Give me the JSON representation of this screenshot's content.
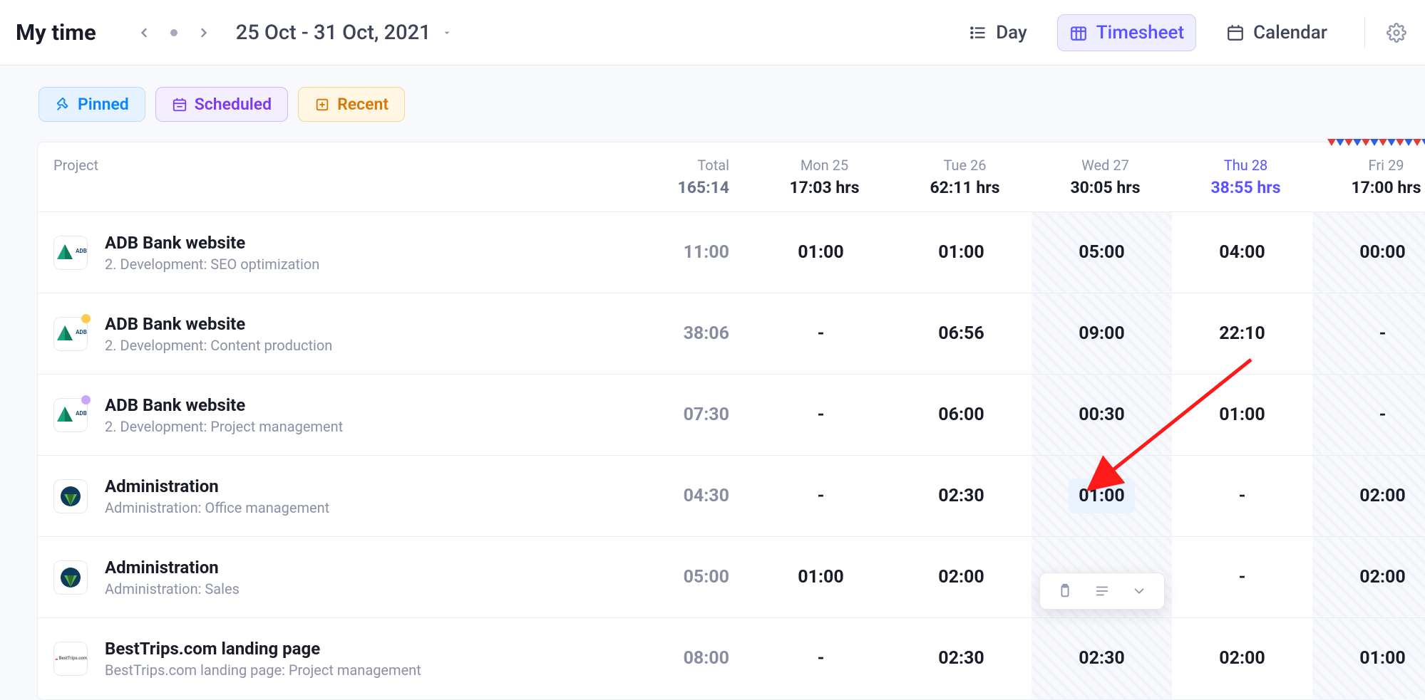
{
  "header": {
    "title": "My time",
    "date_range": "25 Oct - 31 Oct, 2021",
    "views": {
      "day": "Day",
      "timesheet": "Timesheet",
      "calendar": "Calendar"
    }
  },
  "filters": {
    "pinned": "Pinned",
    "scheduled": "Scheduled",
    "recent": "Recent"
  },
  "table": {
    "project_header": "Project",
    "total_header": "Total",
    "grand_total": "165:14",
    "hrs_suffix": "hrs",
    "days": [
      {
        "key": "mon",
        "label": "Mon 25",
        "total": "17:03",
        "today": false,
        "stripe": false,
        "marks": false
      },
      {
        "key": "tue",
        "label": "Tue 26",
        "total": "62:11",
        "today": false,
        "stripe": false,
        "marks": false
      },
      {
        "key": "wed",
        "label": "Wed 27",
        "total": "30:05",
        "today": false,
        "stripe": true,
        "marks": false
      },
      {
        "key": "thu",
        "label": "Thu 28",
        "total": "38:55",
        "today": true,
        "stripe": false,
        "marks": false
      },
      {
        "key": "fri",
        "label": "Fri 29",
        "total": "17:00",
        "today": false,
        "stripe": true,
        "marks": true
      }
    ],
    "rows": [
      {
        "icon": "adb",
        "badge": null,
        "title": "ADB Bank website",
        "subtitle": "2. Development: SEO optimization",
        "total": "11:00",
        "cells": [
          "01:00",
          "01:00",
          "05:00",
          "04:00",
          "00:00"
        ]
      },
      {
        "icon": "adb",
        "badge": "#ffcc4d",
        "title": "ADB Bank website",
        "subtitle": "2. Development: Content production",
        "total": "38:06",
        "cells": [
          "-",
          "06:56",
          "09:00",
          "22:10",
          "-"
        ]
      },
      {
        "icon": "adb",
        "badge": "#c8a8ff",
        "title": "ADB Bank website",
        "subtitle": "2. Development: Project management",
        "total": "07:30",
        "cells": [
          "-",
          "06:00",
          "00:30",
          "01:00",
          "-"
        ]
      },
      {
        "icon": "admin",
        "badge": null,
        "title": "Administration",
        "subtitle": "Administration: Office management",
        "total": "04:30",
        "cells": [
          "-",
          "02:30",
          "01:00",
          "-",
          "02:00"
        ],
        "highlight_day": "wed"
      },
      {
        "icon": "admin",
        "badge": null,
        "title": "Administration",
        "subtitle": "Administration: Sales",
        "total": "05:00",
        "cells": [
          "01:00",
          "02:00",
          "-",
          "-",
          "02:00"
        ],
        "toolbar_day": "wed"
      },
      {
        "icon": "besttrips",
        "badge": null,
        "title": "BestTrips.com landing page",
        "subtitle": "BestTrips.com landing page: Project management",
        "total": "08:00",
        "cells": [
          "-",
          "02:30",
          "02:30",
          "02:00",
          "01:00"
        ]
      }
    ]
  },
  "icons": {
    "adb_label": "ADB",
    "besttrips_label": "BestTrips.com"
  },
  "colors": {
    "accent": "#5b53ff",
    "arrow": "#ff1a1a"
  }
}
